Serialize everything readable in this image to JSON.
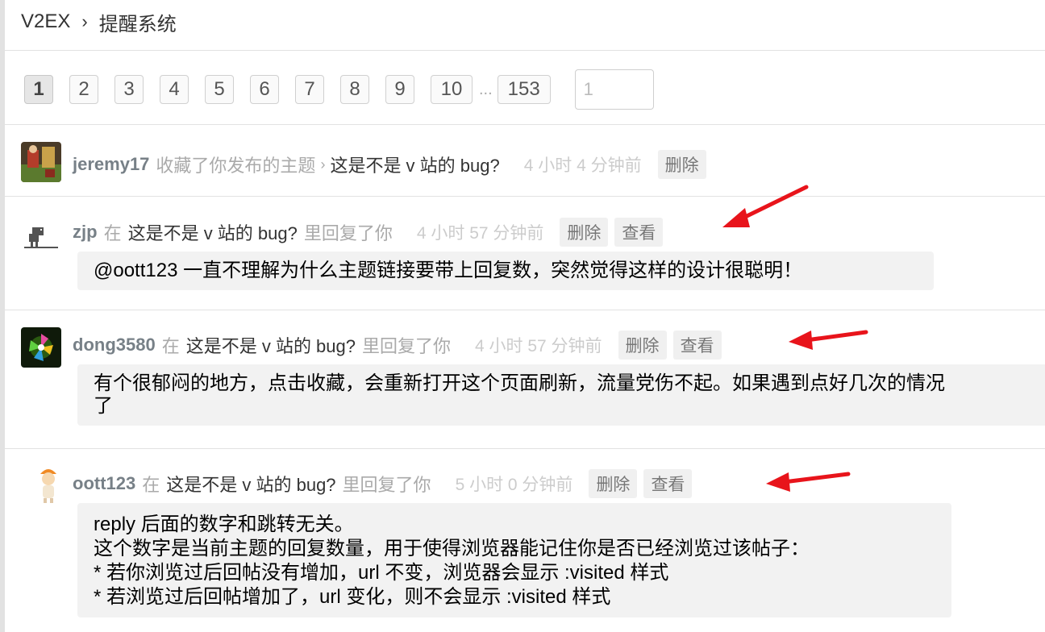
{
  "breadcrumb": {
    "site": "V2EX",
    "separator": "›",
    "page": "提醒系统"
  },
  "pagination": {
    "pages": [
      "1",
      "2",
      "3",
      "4",
      "5",
      "6",
      "7",
      "8",
      "9",
      "10"
    ],
    "ellipsis": "...",
    "last": "153",
    "jump_value": "1",
    "current": "1"
  },
  "notifications": [
    {
      "user": "jeremy17",
      "action": "收藏了你发布的主题",
      "arrow": "›",
      "topic": "这是不是 v 站的 bug?",
      "time": "4 小时 4 分钟前",
      "delete_label": "删除"
    },
    {
      "user": "zjp",
      "pre": "在",
      "topic": "这是不是 v 站的 bug?",
      "action": "里回复了你",
      "time": "4 小时 57 分钟前",
      "delete_label": "删除",
      "view_label": "查看",
      "reply_lines": [
        "@oott123 一直不理解为什么主题链接要带上回复数，突然觉得这样的设计很聪明！"
      ]
    },
    {
      "user": "dong3580",
      "pre": "在",
      "topic": "这是不是 v 站的 bug?",
      "action": "里回复了你",
      "time": "4 小时 57 分钟前",
      "delete_label": "删除",
      "view_label": "查看",
      "reply_lines": [
        "有个很郁闷的地方，点击收藏，会重新打开这个页面刷新，流量党伤不起。如果遇到点好几次的情况",
        "了"
      ]
    },
    {
      "user": "oott123",
      "pre": "在",
      "topic": "这是不是 v 站的 bug?",
      "action": "里回复了你",
      "time": "5 小时 0 分钟前",
      "delete_label": "删除",
      "view_label": "查看",
      "reply_lines": [
        "reply 后面的数字和跳转无关。",
        "这个数字是当前主题的回复数量，用于使得浏览器能记住你是否已经浏览过该帖子：",
        "* 若你浏览过后回帖没有增加，url 不变，浏览器会显示 :visited 样式",
        "* 若浏览过后回帖增加了，url 变化，则不会显示 :visited 样式"
      ]
    }
  ],
  "colors": {
    "username": "#778087",
    "muted": "#aaaaaa",
    "arrow": "#e8141b",
    "reply_bg": "#f2f2f2"
  }
}
